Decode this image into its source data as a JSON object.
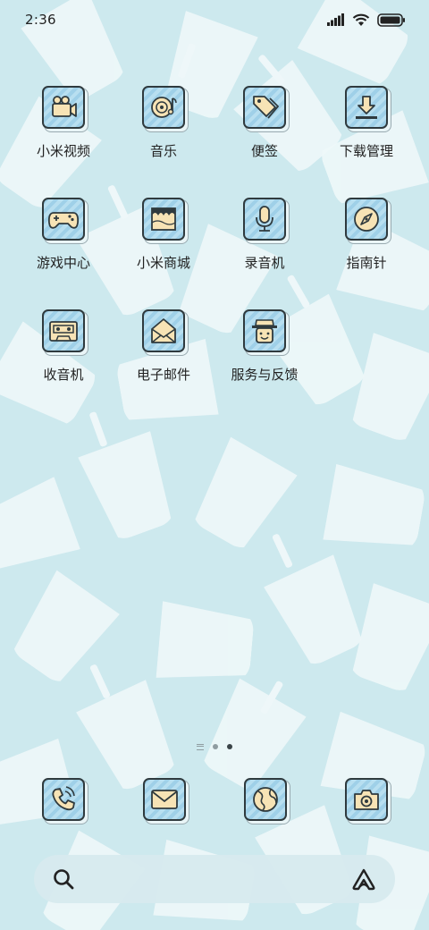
{
  "status_bar": {
    "time": "2:36",
    "icons": [
      "signal-icon",
      "wifi-icon",
      "battery-icon"
    ]
  },
  "apps": [
    {
      "label": "小米视频",
      "icon": "video-camera-icon"
    },
    {
      "label": "音乐",
      "icon": "music-disc-icon"
    },
    {
      "label": "便签",
      "icon": "tag-note-icon"
    },
    {
      "label": "下载管理",
      "icon": "download-icon"
    },
    {
      "label": "游戏中心",
      "icon": "gamepad-icon"
    },
    {
      "label": "小米商城",
      "icon": "store-icon"
    },
    {
      "label": "录音机",
      "icon": "microphone-icon"
    },
    {
      "label": "指南针",
      "icon": "compass-icon"
    },
    {
      "label": "收音机",
      "icon": "radio-cassette-icon"
    },
    {
      "label": "电子邮件",
      "icon": "envelope-open-icon"
    },
    {
      "label": "服务与反馈",
      "icon": "service-person-icon"
    }
  ],
  "page_indicator": {
    "total": 2,
    "active": 2
  },
  "dock": [
    {
      "name": "phone",
      "icon": "phone-icon"
    },
    {
      "name": "messages",
      "icon": "message-envelope-icon"
    },
    {
      "name": "browser",
      "icon": "globe-icon"
    },
    {
      "name": "camera",
      "icon": "camera-icon"
    }
  ],
  "search": {
    "placeholder": "",
    "left_icon": "search-icon",
    "right_icon": "assistant-icon"
  },
  "colors": {
    "background": "#cde9ee",
    "tile_stripe_a": "#9fd0e8",
    "tile_stripe_b": "#b8dff0",
    "icon_fill": "#f7e3b5",
    "outline": "#2f3a3e"
  }
}
